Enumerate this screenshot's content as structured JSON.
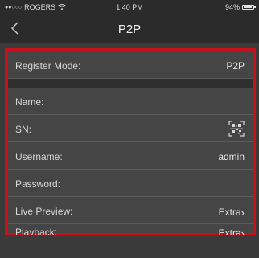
{
  "status_bar": {
    "carrier": "ROGERS",
    "time": "1:40 PM",
    "battery": "94%",
    "battery_level": 0.94
  },
  "nav": {
    "title": "P2P",
    "back_icon": "chevron-left-icon"
  },
  "form": {
    "register_mode": {
      "label": "Register Mode:",
      "value": "P2P"
    },
    "name": {
      "label": "Name:",
      "value": ""
    },
    "sn": {
      "label": "SN:",
      "icon": "qr-scan-icon"
    },
    "username": {
      "label": "Username:",
      "value": "admin"
    },
    "password": {
      "label": "Password:",
      "value": ""
    },
    "live_preview": {
      "label": "Live Preview:",
      "value": "Extra",
      "chevron": "›"
    },
    "playback": {
      "label": "Playback:",
      "value": "Extra",
      "chevron": "›"
    }
  },
  "colors": {
    "highlight_border": "#c8101a",
    "background": "#3a3a3a",
    "nav_background": "#2b2b2b"
  }
}
